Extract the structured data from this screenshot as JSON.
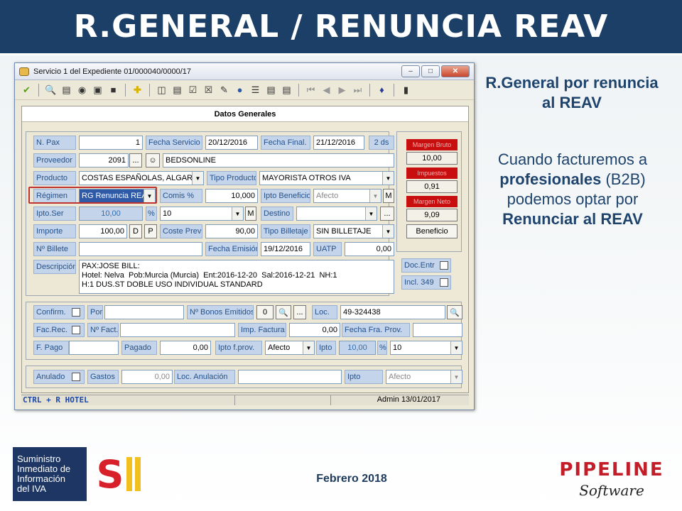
{
  "slide": {
    "title": "R.GENERAL / RENUNCIA REAV",
    "subtitle": "R.General por renuncia al REAV",
    "body_pre": "Cuando facturemos a ",
    "body_b1": "profesionales",
    "body_mid": " (B2B) podemos optar por ",
    "body_b2": "Renunciar al REAV",
    "footer": "Febrero 2018"
  },
  "window": {
    "title": "Servicio 1 del Expediente 01/000040/0000/17",
    "header": "Datos Generales"
  },
  "form": {
    "npax_label": "N. Pax",
    "npax": "1",
    "fecha_servicio_label": "Fecha Servicio",
    "fecha_servicio": "20/12/2016",
    "fecha_final_label": "Fecha Final.",
    "fecha_final": "21/12/2016",
    "dias": "2 ds",
    "proveedor_label": "Proveedor",
    "proveedor_code": "2091",
    "proveedor_name": "BEDSONLINE",
    "producto_label": "Producto",
    "producto": "COSTAS ESPAÑOLAS, ALGARV",
    "tipo_producto_label": "Tipo Producto",
    "tipo_producto": "MAYORISTA OTROS IVA",
    "regimen_label": "Régimen",
    "regimen": "RG Renuncia REA",
    "comis_label": "Comis %",
    "comis": "10,000",
    "ipto_beneficio_label": "Ipto Beneficio",
    "ipto_beneficio": "Afecto",
    "m": "M",
    "iptoser_label": "Ipto.Ser",
    "iptoser": "10,00",
    "pct": "%",
    "iptoser_pct": "10",
    "destino_label": "Destino",
    "destino": "",
    "importe_label": "Importe",
    "importe": "100,00",
    "d": "D",
    "p": "P",
    "coste_prev_label": "Coste Prev",
    "coste_prev": "90,00",
    "tipo_billetaje_label": "Tipo Billetaje",
    "tipo_billetaje": "SIN BILLETAJE",
    "nbillete_label": "Nº Billete",
    "nbillete": "",
    "fecha_emision_label": "Fecha Emisión",
    "fecha_emision": "19/12/2016",
    "uatp_label": "UATP",
    "uatp": "0,00",
    "descripcion_label": "Descripción",
    "descripcion": "PAX:JOSE BILL:\nHotel: Nelva  Pob:Murcia (Murcia)  Ent:2016-12-20  Sal:2016-12-21  NH:1\nH:1 DUS.ST DOBLE USO INDIVIDUAL STANDARD",
    "margen_bruto_label": "Margen Bruto",
    "margen_bruto": "10,00",
    "impuestos_label": "Impuestos",
    "impuestos": "0,91",
    "margen_neto_label": "Margen Neto",
    "margen_neto": "9,09",
    "beneficio_label": "Beneficio",
    "doc_entr_label": "Doc.Entr",
    "incl349_label": "Incl. 349",
    "confirm_label": "Confirm.",
    "por_label": "Por",
    "nbonos_label": "Nº Bonos Emitidos",
    "nbonos": "0",
    "loc_label": "Loc.",
    "loc": "49-324438",
    "facrec_label": "Fac.Rec.",
    "nfact_label": "Nº Fact.",
    "imp_factura_label": "Imp. Factura",
    "imp_factura": "0,00",
    "fecha_fra_label": "Fecha Fra. Prov.",
    "fpago_label": "F. Pago",
    "pagado_label": "Pagado",
    "pagado": "0,00",
    "ipto_fprov_label": "Ipto f.prov.",
    "ipto_fprov": "Afecto",
    "ipto_label": "Ipto",
    "ipto_val": "10,00",
    "ipto_pct": "10",
    "anulado_label": "Anulado",
    "gastos_label": "Gastos",
    "gastos": "0,00",
    "loc_anul_label": "Loc. Anulación",
    "ipto2_label": "Ipto",
    "ipto2": "Afecto"
  },
  "statusbar": {
    "hint": "CTRL + R HOTEL",
    "user": "Admin 13/01/2017"
  },
  "logos": {
    "sii_text1": "Suministro",
    "sii_text2": "Inmediato de",
    "sii_text3": "Información",
    "sii_text4": "del IVA",
    "sii_mark": "S",
    "pipeline": "PIPELINE",
    "software": "Software"
  }
}
